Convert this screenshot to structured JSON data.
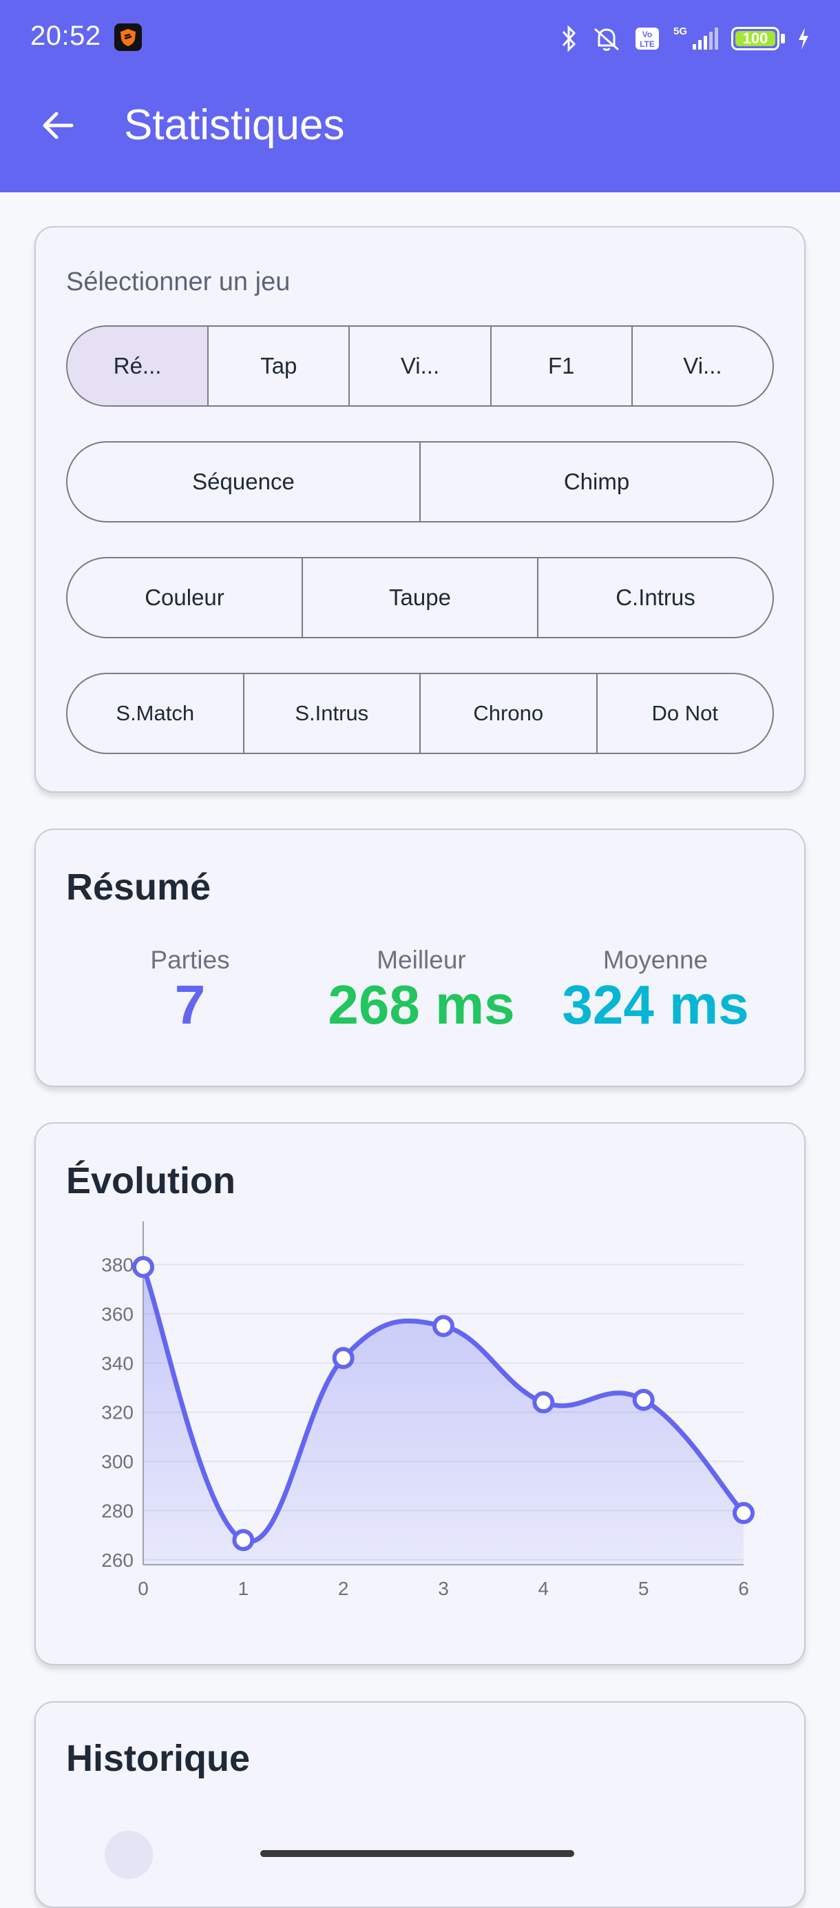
{
  "status_bar": {
    "time": "20:52",
    "battery": "100",
    "network": "5G",
    "volte": "Vo LTE"
  },
  "app_bar": {
    "title": "Statistiques",
    "back_icon": "arrow-left-icon"
  },
  "selector": {
    "label": "Sélectionner un jeu",
    "rows": [
      [
        "Ré...",
        "Tap",
        "Vi...",
        "F1",
        "Vi..."
      ],
      [
        "Séquence",
        "Chimp"
      ],
      [
        "Couleur",
        "Taupe",
        "C.Intrus"
      ],
      [
        "S.Match",
        "S.Intrus",
        "Chrono",
        "Do Not"
      ]
    ],
    "selected": "Ré..."
  },
  "summary": {
    "title": "Résumé",
    "games_label": "Parties",
    "games_value": "7",
    "best_label": "Meilleur",
    "best_value": "268 ms",
    "avg_label": "Moyenne",
    "avg_value": "324 ms"
  },
  "evolution": {
    "title": "Évolution"
  },
  "history": {
    "title": "Historique"
  },
  "colors": {
    "primary": "#6366f1",
    "best": "#22c55e",
    "avg": "#06b6d4"
  },
  "chart_data": {
    "type": "line",
    "x": [
      0,
      1,
      2,
      3,
      4,
      5,
      6
    ],
    "values": [
      379,
      268,
      342,
      355,
      324,
      325,
      279
    ],
    "yticks": [
      260,
      280,
      300,
      320,
      340,
      360,
      380
    ],
    "ylim": [
      258,
      388
    ],
    "xlim": [
      0,
      6
    ],
    "grid": true,
    "area_fill": true
  }
}
